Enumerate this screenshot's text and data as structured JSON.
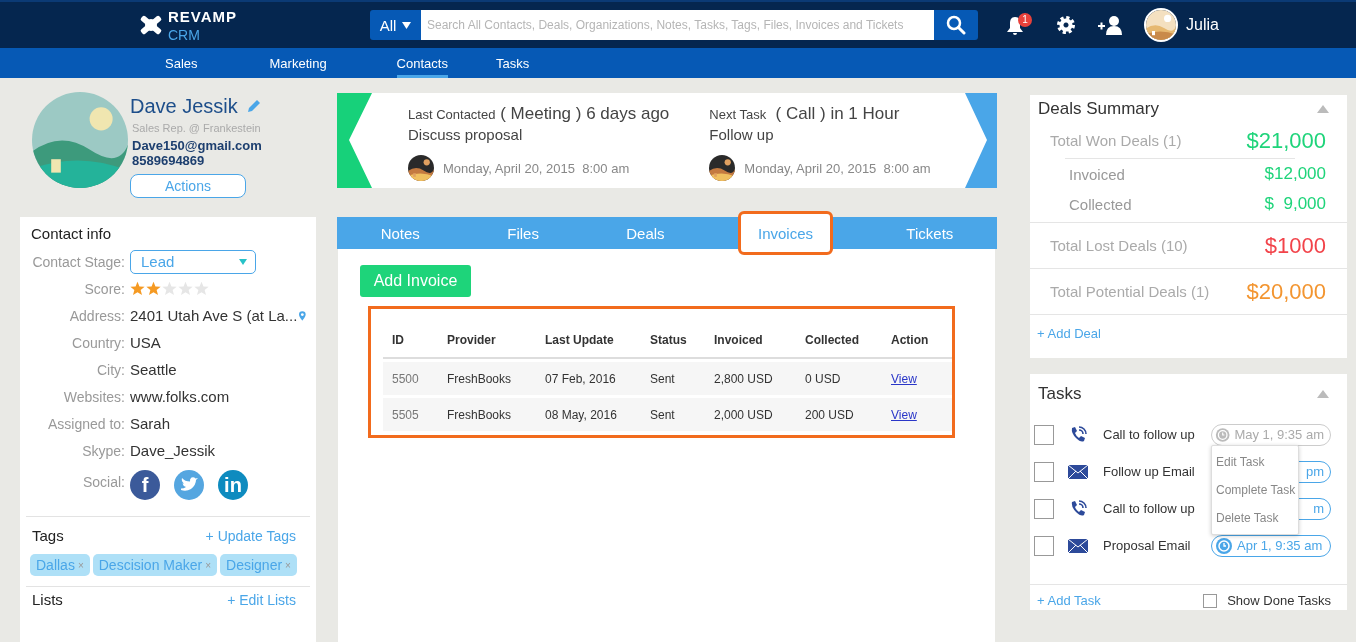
{
  "header": {
    "logo": "REVAMP",
    "logo_sub": "CRM",
    "search_scope": "All",
    "search_placeholder": "Search All Contacts, Deals, Organizations, Notes, Tasks, Tags, Files, Invoices and Tickets",
    "notification_count": "1",
    "user_name": "Julia"
  },
  "nav": [
    {
      "label": "Sales",
      "selected": false
    },
    {
      "label": "Marketing",
      "selected": false
    },
    {
      "label": "Contacts",
      "selected": true
    },
    {
      "label": "Tasks",
      "selected": false
    }
  ],
  "contact": {
    "name": "Dave Jessik",
    "role": "Sales Rep. @ Frankestein",
    "email": "Dave150@gmail.com",
    "phone": "8589694869",
    "actions": "Actions"
  },
  "activity": [
    {
      "kind": "last",
      "label": "Last Contacted",
      "headline": " ( Meeting ) 6 days ago",
      "subject": "Discuss proposal",
      "date": "Monday, April 20, 2015  8:00 am"
    },
    {
      "kind": "next",
      "label": "Next Task",
      "headline": "  ( Call ) in 1 Hour",
      "subject": "Follow up",
      "date": "Monday, April 20, 2015  8:00 am"
    }
  ],
  "contact_info": {
    "title": "Contact info",
    "stage_label": "Contact Stage:",
    "stage": "Lead",
    "score_label": "Score:",
    "stars": 2,
    "fields": [
      {
        "kind": "address",
        "label": "Address:",
        "value": "2401 Utah Ave S (at La..."
      },
      {
        "kind": "text",
        "label": "Country:",
        "value": "USA"
      },
      {
        "kind": "text",
        "label": "City:",
        "value": "Seattle"
      },
      {
        "kind": "text",
        "label": "Websites:",
        "value": "www.folks.com"
      },
      {
        "kind": "text",
        "label": "Assigned to:",
        "value": "Sarah"
      },
      {
        "kind": "text",
        "label": "Skype:",
        "value": "Dave_Jessik"
      }
    ],
    "social_label": "Social:",
    "social": [
      {
        "kind": "facebook",
        "glyph": "f"
      },
      {
        "kind": "twitter"
      },
      {
        "kind": "linkedin",
        "glyph": "in"
      }
    ]
  },
  "tags": {
    "title": "Tags",
    "action": "+ Update Tags",
    "remove": "×",
    "items": [
      "Dallas",
      "Descision Maker",
      "Designer"
    ]
  },
  "lists": {
    "title": "Lists",
    "action": "+ Edit Lists"
  },
  "tabs": [
    {
      "label": "Notes",
      "selected": false,
      "highlighted": false
    },
    {
      "label": "Files",
      "selected": false,
      "highlighted": false
    },
    {
      "label": "Deals",
      "selected": false,
      "highlighted": false
    },
    {
      "label": "Invoices",
      "selected": true,
      "highlighted": true
    },
    {
      "label": "Tickets",
      "selected": false,
      "highlighted": false
    }
  ],
  "add_invoice": "Add Invoice",
  "invoices": {
    "highlighted": true,
    "columns": [
      "ID",
      "Provider",
      "Last Update",
      "Status",
      "Invoiced",
      "Collected",
      "Action"
    ],
    "rows": [
      [
        "5500",
        "FreshBooks",
        "07 Feb, 2016",
        "Sent",
        "2,800 USD",
        "0 USD",
        "View"
      ],
      [
        "5505",
        "FreshBooks",
        "08 May, 2016",
        "Sent",
        "2,000 USD",
        "200 USD",
        "View"
      ]
    ]
  },
  "deals": {
    "title": "Deals Summary",
    "rows": [
      {
        "kind": "total",
        "label": "Total Won Deals (1)",
        "amount": "$21,000",
        "color": "#1ed47a"
      },
      {
        "kind": "sub",
        "label": "Invoiced",
        "amount": "$12,000",
        "color": "#1ed47a"
      },
      {
        "kind": "sub",
        "label": "Collected",
        "amount": "$  9,000",
        "color": "#1ed47a"
      },
      {
        "kind": "total",
        "label": "Total Lost Deals (10)",
        "amount": "$1000",
        "color": "#f2434a"
      },
      {
        "kind": "total",
        "label": "Total Potential Deals (1)",
        "amount": "$20,000",
        "color": "#f39530"
      }
    ],
    "add": "+ Add Deal"
  },
  "tasks": {
    "title": "Tasks",
    "items": [
      {
        "kind": "call",
        "title": "Call to follow up",
        "checked": false,
        "due": "May 1, 9:35 am",
        "menu_open": true,
        "covered": false
      },
      {
        "kind": "email",
        "title": "Follow up Email",
        "checked": false,
        "due": "pm",
        "menu_open": false,
        "covered": true
      },
      {
        "kind": "call",
        "title": "Call to follow up",
        "checked": false,
        "due": "m",
        "menu_open": false,
        "covered": true
      },
      {
        "kind": "email",
        "title": "Proposal Email",
        "checked": false,
        "due": "Apr 1, 9:35 am",
        "menu_open": false,
        "covered": false
      }
    ],
    "menu": [
      "Edit Task",
      "Complete Task",
      "Delete Task"
    ],
    "add": "+ Add Task",
    "show_done": {
      "label": "Show Done Tasks",
      "checked": false
    }
  }
}
